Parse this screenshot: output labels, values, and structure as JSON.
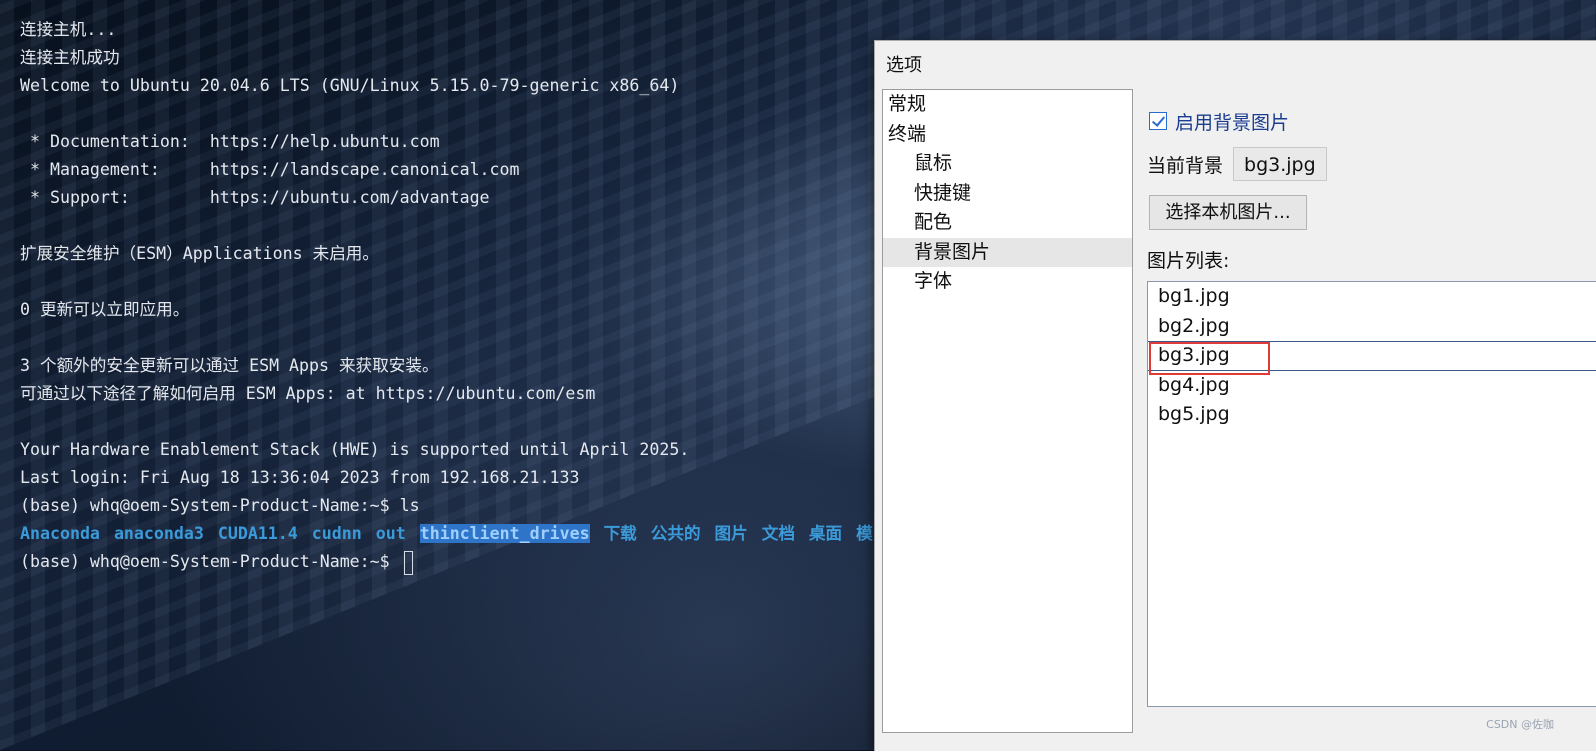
{
  "terminal": {
    "lines": [
      "连接主机...",
      "连接主机成功",
      "Welcome to Ubuntu 20.04.6 LTS (GNU/Linux 5.15.0-79-generic x86_64)",
      "",
      " * Documentation:  https://help.ubuntu.com",
      " * Management:     https://landscape.canonical.com",
      " * Support:        https://ubuntu.com/advantage",
      "",
      "扩展安全维护（ESM）Applications 未启用。",
      "",
      "0 更新可以立即应用。",
      "",
      "3 个额外的安全更新可以通过 ESM Apps 来获取安装。",
      "可通过以下途径了解如何启用 ESM Apps: at https://ubuntu.com/esm",
      "",
      "Your Hardware Enablement Stack (HWE) is supported until April 2025.",
      "Last login: Fri Aug 18 13:36:04 2023 from 192.168.21.133",
      "(base) whq@oem-System-Product-Name:~$ ls"
    ],
    "ls_output": [
      "Anaconda",
      "anaconda3",
      "CUDA11.4",
      "cudnn",
      "out",
      "thinclient_drives",
      "下载",
      "公共的",
      "图片",
      "文档",
      "桌面",
      "模"
    ],
    "selected_ls_item": "thinclient_drives",
    "prompt": "(base) whq@oem-System-Product-Name:~$ "
  },
  "dialog": {
    "title": "选项",
    "categories": [
      {
        "label": "常规",
        "level": 0
      },
      {
        "label": "终端",
        "level": 0
      },
      {
        "label": "鼠标",
        "level": 1
      },
      {
        "label": "快捷键",
        "level": 1
      },
      {
        "label": "配色",
        "level": 1
      },
      {
        "label": "背景图片",
        "level": 1,
        "selected": true
      },
      {
        "label": "字体",
        "level": 1
      }
    ],
    "enable_bg_label": "启用背景图片",
    "enable_bg_checked": true,
    "current_bg_label": "当前背景",
    "current_bg_value": "bg3.jpg",
    "choose_button": "选择本机图片...",
    "list_label": "图片列表:",
    "images": [
      "bg1.jpg",
      "bg2.jpg",
      "bg3.jpg",
      "bg4.jpg",
      "bg5.jpg"
    ],
    "current_image": "bg3.jpg"
  },
  "watermark": "CSDN @佐咖",
  "colors": {
    "ls_item": "#3b9ad9",
    "selection": "#2e74c9",
    "highlight_box": "#e03a3a",
    "checkbox": "#2a6bd1"
  }
}
